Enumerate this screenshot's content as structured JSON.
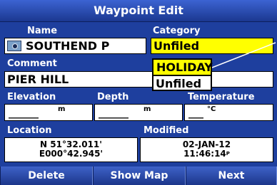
{
  "title": "Waypoint Edit",
  "name": {
    "label": "Name",
    "value": "SOUTHEND P"
  },
  "category": {
    "label": "Category",
    "value": "Unfiled",
    "options": [
      "HOLIDAY",
      "Unfiled"
    ]
  },
  "comment": {
    "label": "Comment",
    "value": "PIER HILL"
  },
  "elevation": {
    "label": "Elevation",
    "value": "______",
    "unit": "m"
  },
  "depth": {
    "label": "Depth",
    "value": "______",
    "unit": "m"
  },
  "temperature": {
    "label": "Temperature",
    "value": "___",
    "unit": "°C"
  },
  "location": {
    "label": "Location",
    "lat": "N  51°32.011'",
    "lon": "E000°42.945'"
  },
  "modified": {
    "label": "Modified",
    "date": "02-JAN-12",
    "time": "11:46:14",
    "time_suffix": "P"
  },
  "buttons": {
    "delete": "Delete",
    "show_map": "Show Map",
    "next": "Next"
  },
  "colors": {
    "background": "#1e3f9e",
    "highlight": "#ffff00"
  },
  "icons": {
    "waypoint": "waypoint-symbol-icon"
  }
}
